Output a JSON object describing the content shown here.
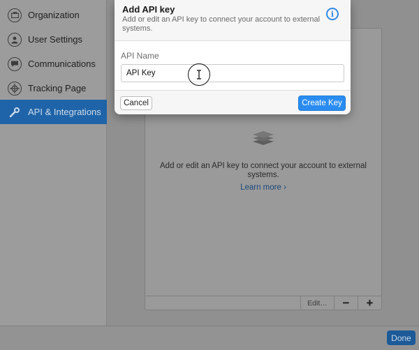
{
  "sidebar": {
    "items": [
      {
        "label": "Organization",
        "icon": "briefcase-icon"
      },
      {
        "label": "User Settings",
        "icon": "user-icon"
      },
      {
        "label": "Communications",
        "icon": "chat-bubble-icon"
      },
      {
        "label": "Tracking Page",
        "icon": "crosshair-icon"
      },
      {
        "label": "API & Integrations",
        "icon": "wrench-icon",
        "active": true
      }
    ]
  },
  "main": {
    "empty_state": {
      "icon": "stack-layers-icon",
      "text": "Add or edit an API key to connect your account to external systems.",
      "link": "Learn more ›"
    },
    "toolbar": {
      "edit_label": "Edit…",
      "remove_label": "−",
      "add_label": "+"
    }
  },
  "footer": {
    "done_label": "Done"
  },
  "modal": {
    "title": "Add API key",
    "subtitle": "Add or edit an API key to connect your account to external systems.",
    "info_icon": "info-icon",
    "field_label": "API Name",
    "field_value": "API Key",
    "cancel_label": "Cancel",
    "create_label": "Create Key"
  },
  "colors": {
    "accent": "#2a8cf0",
    "sidebar_active": "#1f64a8",
    "overlay_dim": "#8f8f8f"
  }
}
